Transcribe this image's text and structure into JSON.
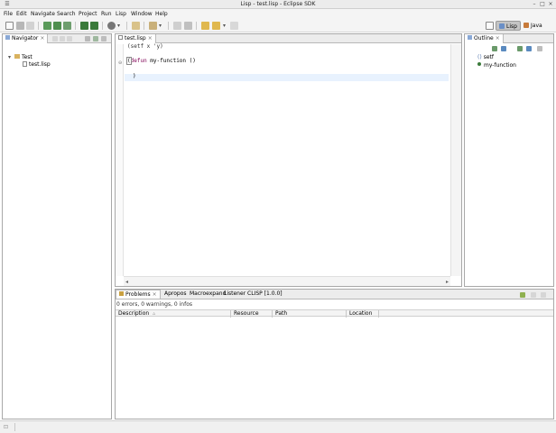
{
  "window": {
    "title": "Lisp - test.lisp - Eclipse SDK"
  },
  "menu": [
    "File",
    "Edit",
    "Navigate",
    "Search",
    "Project",
    "Run",
    "Lisp",
    "Window",
    "Help"
  ],
  "perspectives": {
    "lisp": "Lisp",
    "java": "Java"
  },
  "navigator": {
    "tab_label": "Navigator",
    "project": "Test",
    "file": "test.lisp"
  },
  "editor": {
    "tab_label": "test.lisp",
    "lines": {
      "l1_rest": "(setf x 'y)",
      "l2_paren": "(",
      "l2_kw": "defun",
      "l2_rest": " my-function ()",
      "l3": ")"
    }
  },
  "outline": {
    "tab_label": "Outline",
    "items": [
      "setf",
      "my-function"
    ]
  },
  "bottom": {
    "tabs": [
      "Problems",
      "Apropos",
      "Macroexpand",
      "Listener CLISP [1.0.0]"
    ],
    "summary": "0 errors, 0 warnings, 0 infos",
    "columns": [
      "Description",
      "Resource",
      "Path",
      "Location"
    ]
  },
  "colors": {
    "accent": "#7f0055",
    "line_highlight": "#e8f2fe"
  }
}
